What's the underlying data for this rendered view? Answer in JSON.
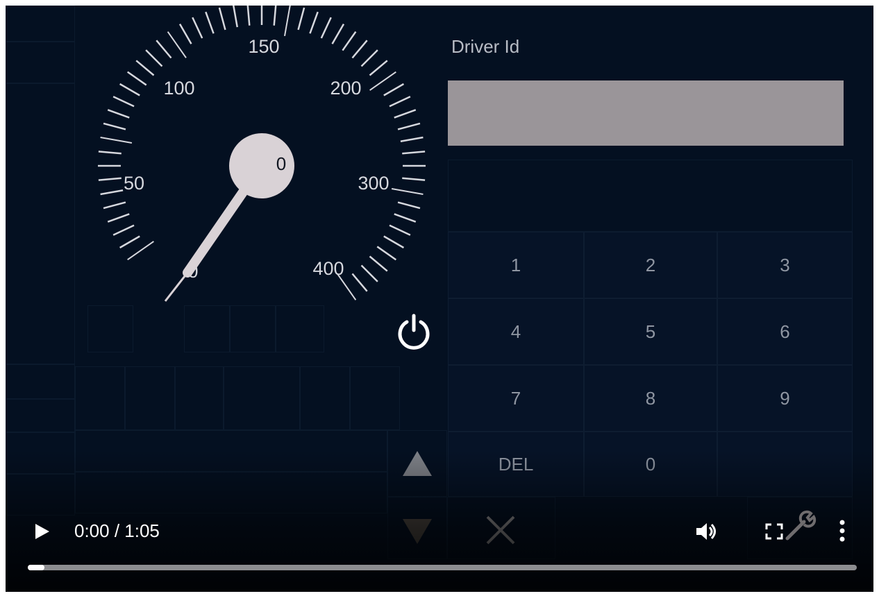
{
  "gauge": {
    "tick_labels": [
      "0",
      "50",
      "100",
      "150",
      "200",
      "300",
      "400"
    ],
    "digital_value": "0",
    "needle_value": 0
  },
  "driver": {
    "label": "Driver Id",
    "value": ""
  },
  "keypad": {
    "keys": [
      "1",
      "2",
      "3",
      "4",
      "5",
      "6",
      "7",
      "8",
      "9",
      "DEL",
      "0"
    ]
  },
  "video": {
    "time": "0:00 / 1:05",
    "progress": 0.02
  },
  "icons": {
    "power": "power-icon",
    "up": "triangle-up-icon",
    "down": "triangle-down-icon",
    "close": "close-icon",
    "play": "play-icon",
    "volume": "volume-icon",
    "fullscreen": "fullscreen-icon",
    "settings": "wrench-icon",
    "more": "more-vertical-icon"
  },
  "colors": {
    "background": "#041021",
    "dial": "#d9d2d6",
    "input": "#9a9599",
    "accent": "#ffffff"
  }
}
